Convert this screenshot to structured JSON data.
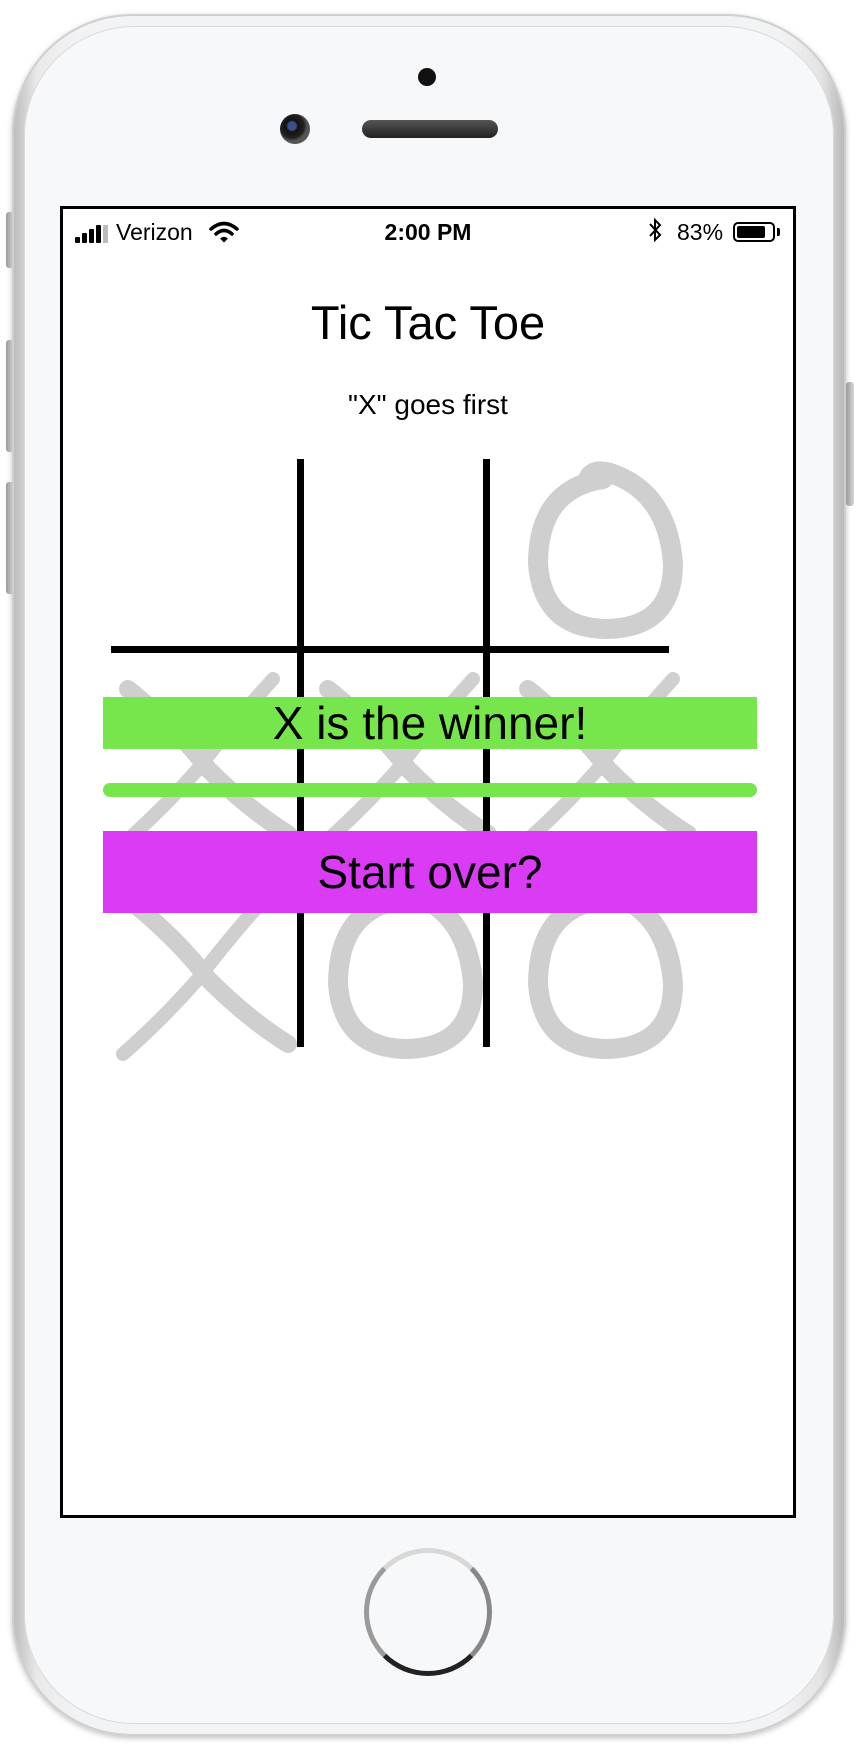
{
  "status_bar": {
    "carrier": "Verizon",
    "time": "2:00 PM",
    "battery_percent": "83%",
    "battery_level": 0.83
  },
  "app": {
    "title": "Tic Tac Toe",
    "subtitle": "\"X\" goes first"
  },
  "board": {
    "cells": [
      "",
      "",
      "O",
      "X",
      "X",
      "X",
      "X",
      "O",
      "O"
    ],
    "winning_row": 2
  },
  "result": {
    "message": "X is the winner!",
    "highlight_color": "#77e64c"
  },
  "actions": {
    "start_over_label": "Start over?",
    "start_over_color": "#da3bf5"
  },
  "icons": {
    "signal": "signal-bars-icon",
    "wifi": "wifi-icon",
    "bluetooth": "bluetooth-icon",
    "battery": "battery-icon"
  }
}
